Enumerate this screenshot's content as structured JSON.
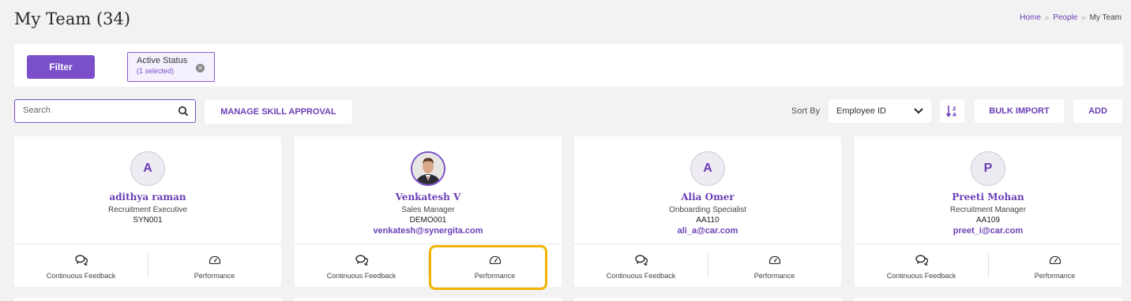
{
  "page": {
    "title": "My Team (34)"
  },
  "breadcrumb": {
    "home": "Home",
    "people": "People",
    "current": "My Team"
  },
  "filter": {
    "button_label": "Filter",
    "chip_title": "Active Status",
    "chip_sub": "(1 selected)"
  },
  "toolbar": {
    "search_placeholder": "Search",
    "manage_skill_label": "MANAGE SKILL APPROVAL",
    "sort_by_label": "Sort By",
    "sort_value": "Employee ID",
    "bulk_import_label": "BULK IMPORT",
    "add_label": "ADD"
  },
  "actions": {
    "feedback_label": "Continuous Feedback",
    "performance_label": "Performance"
  },
  "cards": [
    {
      "initial": "A",
      "name": "adithya raman",
      "role": "Recruitment Executive",
      "id": "SYN001",
      "email": ""
    },
    {
      "initial": "",
      "name": "Venkatesh V",
      "role": "Sales Manager",
      "id": "DEMO001",
      "email": "venkatesh@synergita.com"
    },
    {
      "initial": "A",
      "name": "Alia Omer",
      "role": "Onboarding Specialist",
      "id": "AA110",
      "email": "ali_a@car.com"
    },
    {
      "initial": "P",
      "name": "Preeti Mohan",
      "role": "Recruitment Manager",
      "id": "AA109",
      "email": "preet_i@car.com"
    }
  ],
  "colors": {
    "accent": "#7a4fc9",
    "highlight": "#f0b400",
    "background": "#f2f2f2"
  }
}
